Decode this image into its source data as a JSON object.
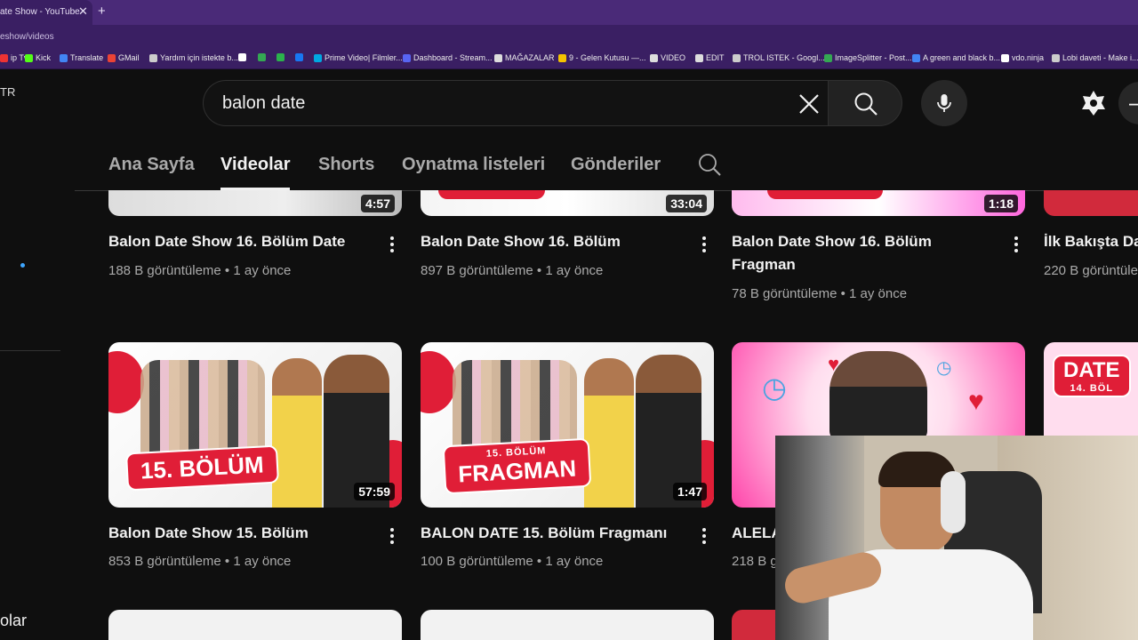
{
  "browser": {
    "tab_title": "ate Show - YouTube",
    "url": "eshow/videos",
    "bookmarks": [
      {
        "label": "ip Tv",
        "icon": "tv-icon",
        "color": "#e33"
      },
      {
        "label": "Kick",
        "icon": "kick-icon",
        "color": "#53fc18"
      },
      {
        "label": "Translate",
        "icon": "translate-icon",
        "color": "#4285f4"
      },
      {
        "label": "GMail",
        "icon": "gmail-icon",
        "color": "#ea4335"
      },
      {
        "label": "Yardım için istekte b...",
        "icon": "help-icon",
        "color": "#ccc"
      },
      {
        "label": "",
        "icon": "x-icon",
        "color": "#fff"
      },
      {
        "label": "",
        "icon": "drive-icon",
        "color": "#34a853"
      },
      {
        "label": "",
        "icon": "green-icon",
        "color": "#2bb24c"
      },
      {
        "label": "",
        "icon": "facebook-icon",
        "color": "#1877f2"
      },
      {
        "label": "Prime Video| Filmler...",
        "icon": "prime-icon",
        "color": "#00a8e1"
      },
      {
        "label": "Dashboard - Stream...",
        "icon": "dashboard-icon",
        "color": "#5865f2"
      },
      {
        "label": "MAĞAZALAR",
        "icon": "folder-icon",
        "color": "#ddd"
      },
      {
        "label": "9 - Gelen Kutusu —...",
        "icon": "mail-icon",
        "color": "#f5c400"
      },
      {
        "label": "VIDEO",
        "icon": "folder-icon",
        "color": "#ddd"
      },
      {
        "label": "EDIT",
        "icon": "folder-icon",
        "color": "#ddd"
      },
      {
        "label": "TROL ISTEK - Googl...",
        "icon": "sheets-icon",
        "color": "#ccc"
      },
      {
        "label": "ImageSplitter - Post...",
        "icon": "image-icon",
        "color": "#34a853"
      },
      {
        "label": "A green and black b...",
        "icon": "doc-icon",
        "color": "#4285f4"
      },
      {
        "label": "vdo.ninja",
        "icon": "ninja-icon",
        "color": "#fff"
      },
      {
        "label": "Lobi daveti - Make i...",
        "icon": "lobby-icon",
        "color": "#ccc"
      }
    ]
  },
  "sidebar": {
    "top_label": "TR",
    "bottom_label": "olar"
  },
  "search": {
    "query": "balon date"
  },
  "channel_tabs": [
    "Ana Sayfa",
    "Videolar",
    "Shorts",
    "Oynatma listeleri",
    "Gönderiler"
  ],
  "active_tab": "Videolar",
  "videos_row1": [
    {
      "duration": "4:57",
      "title": "Balon Date Show 16. Bölüm Date",
      "title_line2": "",
      "meta": "188 B görüntüleme • 1 ay önce"
    },
    {
      "duration": "33:04",
      "title": "Balon Date Show 16. Bölüm",
      "title_line2": "",
      "meta": "897 B görüntüleme • 1 ay önce"
    },
    {
      "duration": "1:18",
      "title": "Balon Date Show 16. Bölüm",
      "title_line2": "Fragman",
      "meta": "78 B görüntüleme • 1 ay önce"
    },
    {
      "duration": "",
      "title": "İlk Bakışta Da",
      "title_line2": "",
      "meta": "220 B görüntüle"
    }
  ],
  "videos_row2": [
    {
      "duration": "57:59",
      "badge": "15. BÖLÜM",
      "badge_small": "",
      "title": "Balon Date Show 15. Bölüm",
      "meta": "853 B görüntüleme • 1 ay önce"
    },
    {
      "duration": "1:47",
      "badge": "FRAGMAN",
      "badge_small": "15. BÖLÜM",
      "title": "BALON DATE 15. Bölüm Fragmanı",
      "meta": "100 B görüntüleme • 1 ay önce"
    },
    {
      "duration": "",
      "badge": "",
      "badge_small": "",
      "title": "ALELA",
      "meta": "218 B g"
    },
    {
      "duration": "",
      "badge": "DATE",
      "badge_small": "14. BÖL",
      "title": "",
      "meta": ""
    }
  ],
  "colors": {
    "browser_tabbar": "#4a2a78",
    "browser_toolbar": "#3a1f63",
    "yt_background": "#0f0f0f",
    "thumbnail_red": "#e01e37",
    "link_blue": "#3ea6ff"
  }
}
